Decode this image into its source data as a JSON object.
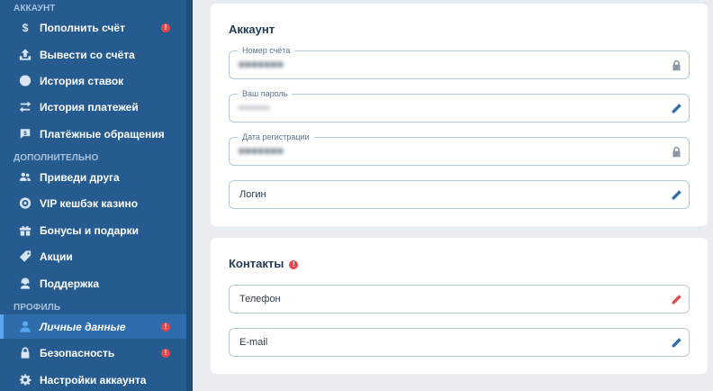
{
  "sidebar": {
    "sections": [
      {
        "title": "АККАУНТ"
      },
      {
        "title": "ДОПОЛНИТЕЛЬНО"
      },
      {
        "title": "ПРОФИЛЬ"
      }
    ],
    "items": [
      {
        "label": "Пополнить счёт",
        "icon": "dollar-icon",
        "alert": "!"
      },
      {
        "label": "Вывести со счёта",
        "icon": "upload-icon"
      },
      {
        "label": "История ставок",
        "icon": "clock-icon"
      },
      {
        "label": "История платежей",
        "icon": "arrows-icon"
      },
      {
        "label": "Платёжные обращения",
        "icon": "payment-chat-icon"
      },
      {
        "label": "Приведи друга",
        "icon": "users-icon"
      },
      {
        "label": "VIP кешбэк казино",
        "icon": "casino-chip-icon"
      },
      {
        "label": "Бонусы и подарки",
        "icon": "gift-icon"
      },
      {
        "label": "Акции",
        "icon": "tag-icon"
      },
      {
        "label": "Поддержка",
        "icon": "support-icon"
      },
      {
        "label": "Личные данные",
        "icon": "user-icon",
        "alert": "!",
        "active": true
      },
      {
        "label": "Безопасность",
        "icon": "lock-icon",
        "alert": "!"
      },
      {
        "label": "Настройки аккаунта",
        "icon": "gear-icon"
      }
    ]
  },
  "account_card": {
    "title": "Аккаунт",
    "fields": [
      {
        "label": "Номер счёта",
        "value": "■■■■■■■",
        "icon": "lock-icon"
      },
      {
        "label": "Ваш пароль",
        "value": "••••••••",
        "icon": "pencil-icon"
      },
      {
        "label": "Дата регистрации",
        "value": "■■■■■■■",
        "icon": "lock-icon"
      },
      {
        "placeholder": "Логин",
        "icon": "pencil-icon"
      }
    ]
  },
  "contacts_card": {
    "title": "Контакты",
    "alert": "!",
    "fields": [
      {
        "placeholder": "Телефон",
        "icon": "pencil-icon",
        "icon_color": "#e5474b"
      },
      {
        "placeholder": "E-mail",
        "icon": "pencil-icon"
      }
    ]
  },
  "colors": {
    "sidebar_bg": "#255b8f",
    "active_item": "#2e6cab",
    "alert": "#e5474b",
    "accent": "#2c6fb0",
    "page_bg": "#e9edf2"
  }
}
